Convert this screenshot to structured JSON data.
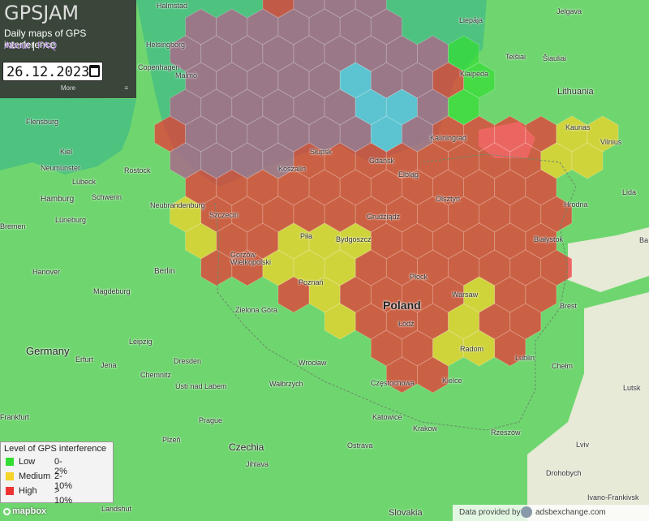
{
  "app": {
    "title": "GPSJAM",
    "subtitle": "Daily maps of GPS interference",
    "about_link": "About",
    "separator": "|",
    "faq_link": "FAQ",
    "date_value": "26.12.2023",
    "more_label": "More",
    "more_icon": "≡"
  },
  "legend": {
    "title": "Level of GPS interference",
    "items": [
      {
        "label": "Low",
        "range": "0-2%",
        "color": "#33dd33"
      },
      {
        "label": "Medium",
        "range": "2-10%",
        "color": "#f5d327"
      },
      {
        "label": "High",
        "range": "> 10%",
        "color": "#ee3333"
      }
    ]
  },
  "map": {
    "attribution_logo": "mapbox",
    "credit_text": "Data provided by",
    "credit_source": "adsbexchange.com",
    "colors": {
      "land": "#6fd66f",
      "water": "#4ec27f",
      "low": "#33dd33",
      "medium": "#f5d327",
      "high": "#ee3333",
      "high_sea": "#a86b8a",
      "neutral": "#e6ead6",
      "blue": "#63c5f0"
    },
    "places": {
      "halmstad": "Halmstad",
      "helsingborg": "Helsingborg",
      "copenhagen": "Copenhagen",
      "malmo": "Malmö",
      "flensburg": "Flensburg",
      "kiel": "Kiel",
      "neumunster": "Neumünster",
      "lubeck": "Lübeck",
      "rostock": "Rostock",
      "hamburg": "Hamburg",
      "schwerin": "Schwerin",
      "neubrandenburg": "Neubrandenburg",
      "szczecin": "Szczecin",
      "bremen": "Bremen",
      "luneburg": "Lüneburg",
      "gorzow": "Gorzów\nWielkopolski",
      "berlin": "Berlin",
      "hanover": "Hanover",
      "magdeburg": "Magdeburg",
      "leipzig": "Leipzig",
      "dresden": "Dresden",
      "erfurt": "Erfurt",
      "jena": "Jena",
      "chemnitz": "Chemnitz",
      "usti": "Ústí nad Labem",
      "germany": "Germany",
      "frankfurt": "Frankfurt",
      "prague": "Prague",
      "plzen": "Plzeň",
      "czechia": "Czechia",
      "jihlava": "Jihlava",
      "landshut": "Landshut",
      "zielona": "Zielona Góra",
      "wroclaw": "Wrocław",
      "walbrzych": "Wałbrzych",
      "katowice": "Katowice",
      "czestochowa": "Częstochowa",
      "krakow": "Krakow",
      "ostrava": "Ostrava",
      "slovakia": "Slovakia",
      "rzeszow": "Rzeszów",
      "kielce": "Kielce",
      "radom": "Radom",
      "lublin": "Lublin",
      "lodz": "Łódź",
      "warsaw": "Warsaw",
      "poland": "Poland",
      "plock": "Płock",
      "poznan": "Poznań",
      "pila": "Piła",
      "bydgoszcz": "Bydgoszcz",
      "grudziadz": "Grudziądz",
      "olsztyn": "Olsztyn",
      "bialystok": "Białystok",
      "hrodna": "Hrodna",
      "brest": "Brest",
      "chelm": "Chełm",
      "lutsk": "Lutsk",
      "lviv": "Lviv",
      "drohobych": "Drohobych",
      "ivano": "Ivano-Frankivsk",
      "gdansk": "Gdańsk",
      "elblag": "Elbląg",
      "slupsk": "Słupsk",
      "koszalin": "Koszalin",
      "kaliningrad": "Kaliningrad",
      "klaipeda": "Klaipėda",
      "liepaja": "Liepāja",
      "jelgava": "Jelgava",
      "telsiai": "Telšiai",
      "siauliai": "Šiauliai",
      "lithuania": "Lithuania",
      "kaunas": "Kaunas",
      "vilnius": "Vilnius",
      "lida": "Lida",
      "ba": "Ba"
    }
  }
}
